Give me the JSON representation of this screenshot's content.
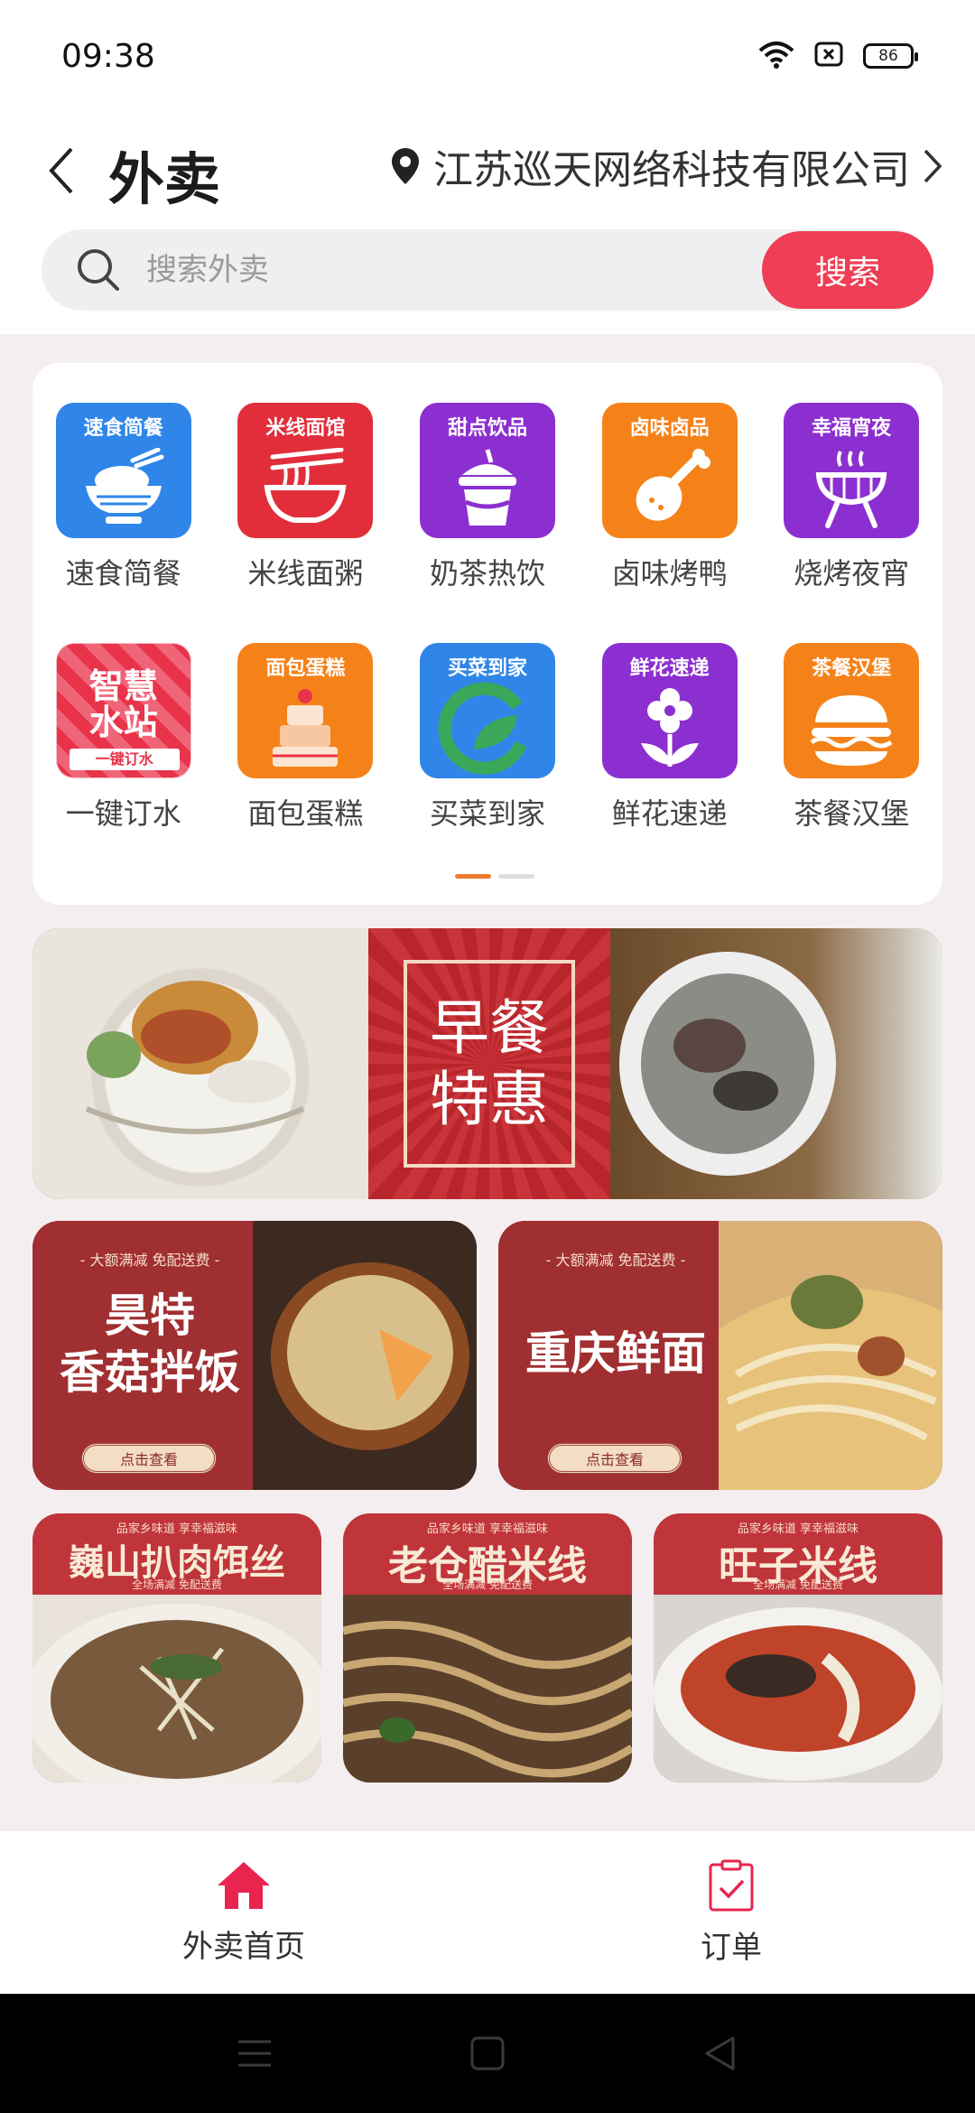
{
  "status_bar": {
    "time": "09:38",
    "battery": "86"
  },
  "header": {
    "title": "外卖",
    "location": "江苏巡天网络科技有限公司"
  },
  "search": {
    "placeholder": "搜索外卖",
    "button_label": "搜索"
  },
  "categories": [
    {
      "tile_label": "速食简餐",
      "label": "速食简餐",
      "color": "#2f86e8",
      "icon": "rice-bowl-icon"
    },
    {
      "tile_label": "米线面馆",
      "label": "米线面粥",
      "color": "#e12e3a",
      "icon": "noodle-bowl-icon"
    },
    {
      "tile_label": "甜点饮品",
      "label": "奶茶热饮",
      "color": "#8c2fd0",
      "icon": "milk-tea-icon"
    },
    {
      "tile_label": "卤味卤品",
      "label": "卤味烤鸭",
      "color": "#f58219",
      "icon": "drumstick-icon"
    },
    {
      "tile_label": "幸福宵夜",
      "label": "烧烤夜宵",
      "color": "#8c2fd0",
      "icon": "grill-icon"
    },
    {
      "tile_label": "智慧水站",
      "label": "一键订水",
      "color": "#e8334a",
      "icon": "water-station-icon"
    },
    {
      "tile_label": "面包蛋糕",
      "label": "面包蛋糕",
      "color": "#f58219",
      "icon": "cake-icon"
    },
    {
      "tile_label": "买菜到家",
      "label": "买菜到家",
      "color": "#2f86e8",
      "icon": "vegetable-leaf-icon"
    },
    {
      "tile_label": "鲜花速递",
      "label": "鲜花速递",
      "color": "#8c2fd0",
      "icon": "flower-icon"
    },
    {
      "tile_label": "茶餐汉堡",
      "label": "茶餐汉堡",
      "color": "#f58219",
      "icon": "burger-icon"
    }
  ],
  "water_station_badge": "一键订水",
  "pager": {
    "current": 1,
    "total": 2
  },
  "banner": {
    "title": "早餐特惠"
  },
  "promos": [
    {
      "subtitle": "- 大额满减 免配送费 -",
      "title": "昊特\n香菇拌饭",
      "button": "点击查看"
    },
    {
      "subtitle": "- 大额满减 免配送费 -",
      "title": "重庆鲜面",
      "button": "点击查看"
    }
  ],
  "tiles": [
    {
      "note": "品家乡味道 享幸福滋味",
      "title": "巍山扒肉饵丝",
      "sub": "全场满减 免配送费"
    },
    {
      "note": "品家乡味道 享幸福滋味",
      "title": "老仓醋米线",
      "sub": "全场满减 免配送费"
    },
    {
      "note": "品家乡味道 享幸福滋味",
      "title": "旺子米线",
      "sub": "全场满减 免配送费"
    }
  ],
  "tab_bar": {
    "home_label": "外卖首页",
    "orders_label": "订单",
    "accent": "#e8254f"
  },
  "colors": {
    "accent": "#ef3e55",
    "pager_active": "#f07a2f",
    "banner_red": "#b7282d"
  }
}
